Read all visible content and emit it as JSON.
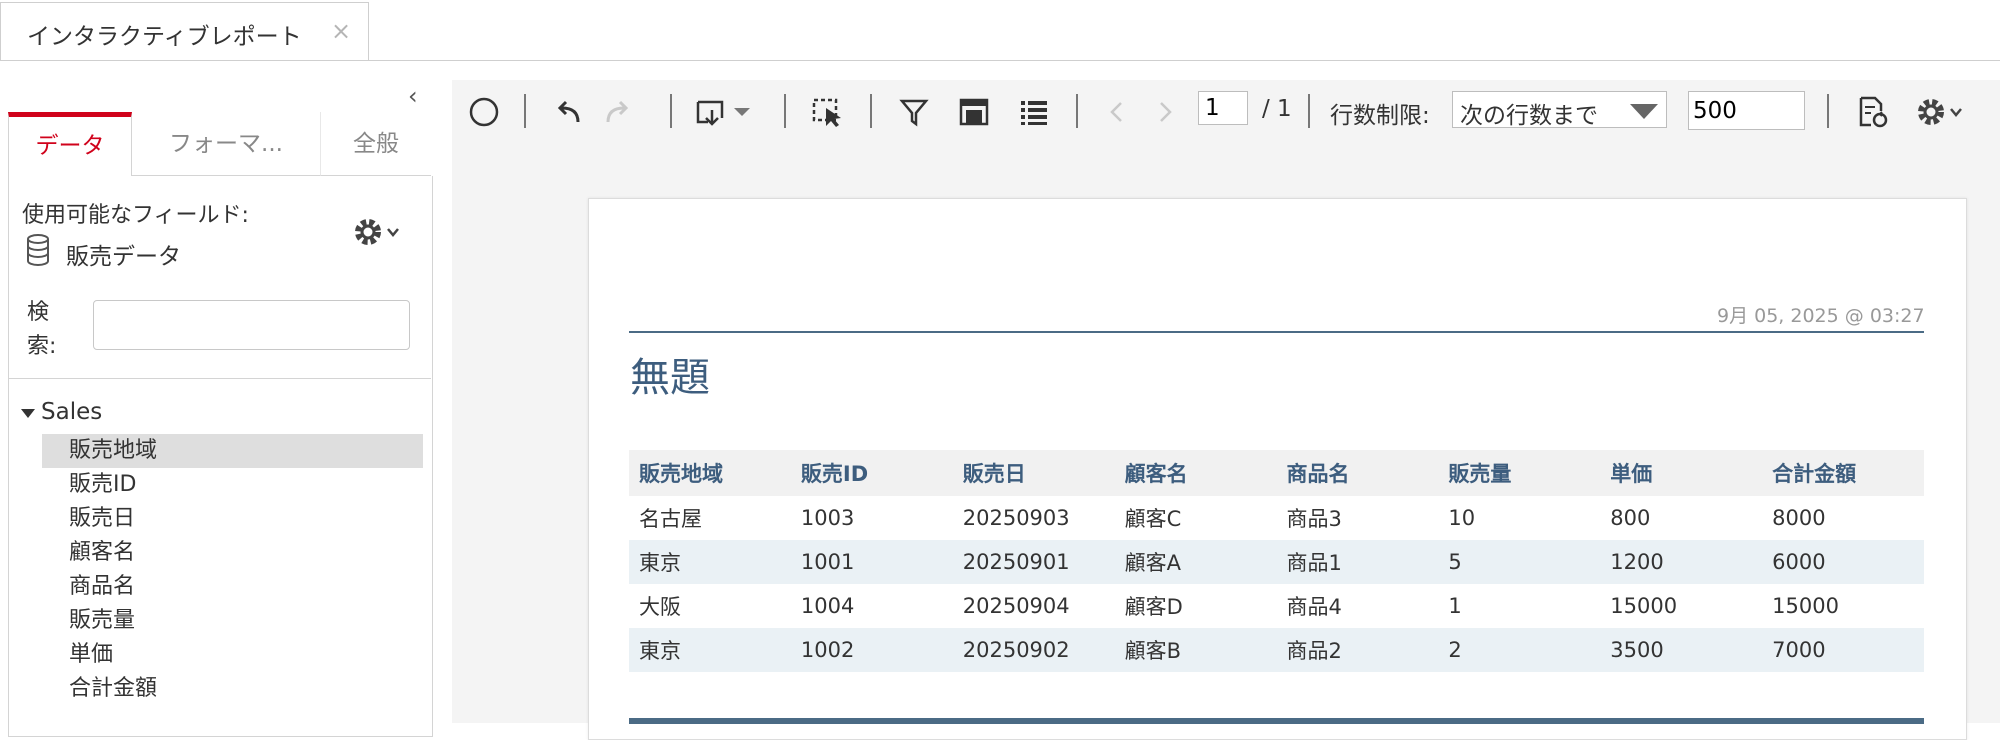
{
  "window": {
    "tab_title": "インタラクティブレポート",
    "tab_close": "×"
  },
  "left_panel": {
    "collapse_glyph": "‹",
    "tabs": [
      {
        "label": "データ",
        "active": true
      },
      {
        "label": "フォーマ...",
        "active": false
      },
      {
        "label": "全般",
        "active": false
      }
    ],
    "fields_label": "使用可能なフィールド:",
    "data_source": "販売データ",
    "search_label": "検索:",
    "search_value": "",
    "tree": {
      "root": "Sales",
      "expanded": true,
      "items": [
        "販売地域",
        "販売ID",
        "販売日",
        "顧客名",
        "商品名",
        "販売量",
        "単価",
        "合計金額"
      ],
      "selected_index": 0
    }
  },
  "toolbar": {
    "buttons": [
      "circle-icon",
      "undo-icon",
      "redo-icon",
      "insert-dropdown-icon",
      "select-icon",
      "filter-icon",
      "table-layout-icon",
      "list-icon",
      "prev-page-icon",
      "next-page-icon",
      "export-icon",
      "settings-icon"
    ],
    "page_current": "1",
    "page_total": "/ 1",
    "row_limit_label": "行数制限:",
    "row_limit_option": "次の行数まで",
    "row_limit_value": "500"
  },
  "report": {
    "timestamp": "9月 05, 2025 @ 03:27",
    "title": "無題",
    "columns": [
      "販売地域",
      "販売ID",
      "販売日",
      "顧客名",
      "商品名",
      "販売量",
      "単価",
      "合計金額"
    ],
    "rows": [
      [
        "名古屋",
        "1003",
        "20250903",
        "顧客C",
        "商品3",
        "10",
        "800",
        "8000"
      ],
      [
        "東京",
        "1001",
        "20250901",
        "顧客A",
        "商品1",
        "5",
        "1200",
        "6000"
      ],
      [
        "大阪",
        "1004",
        "20250904",
        "顧客D",
        "商品4",
        "1",
        "15000",
        "15000"
      ],
      [
        "東京",
        "1002",
        "20250902",
        "顧客B",
        "商品2",
        "2",
        "3500",
        "7000"
      ]
    ]
  },
  "colors": {
    "accent_red": "#d0021b",
    "header_blue": "#3d5d7e",
    "row_alt": "#eaf1f5"
  }
}
